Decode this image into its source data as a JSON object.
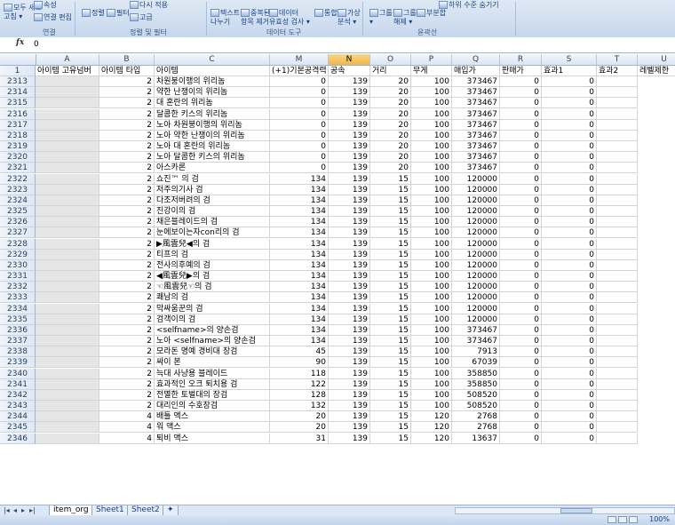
{
  "ribbon": {
    "buttons": [
      {
        "name": "refresh-all-button",
        "label": "모두 새로\n고침 ▾"
      },
      {
        "name": "properties-button",
        "label": "속성"
      },
      {
        "name": "edit-links-button",
        "label": "연결 편집"
      },
      {
        "name": "sort-button",
        "label": "정렬"
      },
      {
        "name": "filter-button",
        "label": "필터"
      },
      {
        "name": "reapply-button",
        "label": "다시 적용"
      },
      {
        "name": "advanced-button",
        "label": "고급"
      },
      {
        "name": "text-to-columns-button",
        "label": "텍스트\n나누기"
      },
      {
        "name": "remove-duplicates-button",
        "label": "중복된\n항목 제거"
      },
      {
        "name": "data-validation-button",
        "label": "데이터\n유효성 검사 ▾"
      },
      {
        "name": "consolidate-button",
        "label": "통합"
      },
      {
        "name": "what-if-button",
        "label": "가상\n분석 ▾"
      },
      {
        "name": "group-button",
        "label": "그룹\n▾"
      },
      {
        "name": "ungroup-button",
        "label": "그룹\n해제 ▾"
      },
      {
        "name": "subtotal-button",
        "label": "부분합"
      },
      {
        "name": "hide-detail-button",
        "label": "하위 수준 숨기기"
      }
    ],
    "groups": [
      "연결",
      "정렬 및 필터",
      "데이터 도구",
      "윤곽선"
    ]
  },
  "formula_bar": {
    "fx": "fx",
    "value": "0"
  },
  "columns": [
    {
      "letter": "A",
      "header": "아이템 고유넘버"
    },
    {
      "letter": "B",
      "header": "아이템 타입"
    },
    {
      "letter": "C",
      "header": "아이템"
    },
    {
      "letter": "M",
      "header": "(+1)기본공격력"
    },
    {
      "letter": "N",
      "header": "공속"
    },
    {
      "letter": "O",
      "header": "거리"
    },
    {
      "letter": "P",
      "header": "무게"
    },
    {
      "letter": "Q",
      "header": "매입가"
    },
    {
      "letter": "R",
      "header": "판매가"
    },
    {
      "letter": "S",
      "header": "효과1"
    },
    {
      "letter": "T",
      "header": "효과2"
    },
    {
      "letter": "U",
      "header": "레벨제한"
    }
  ],
  "header_row_number": "1",
  "rows": [
    [
      "2313",
      "",
      "2",
      "차원붕이행의 위리놈",
      "0",
      "139",
      "20",
      "100",
      "373467",
      "0",
      "0",
      ""
    ],
    [
      "2314",
      "",
      "2",
      "약한 난쟁이의 위리놈",
      "0",
      "139",
      "20",
      "100",
      "373467",
      "0",
      "0",
      ""
    ],
    [
      "2315",
      "",
      "2",
      "대 혼란의 위리놈",
      "0",
      "139",
      "20",
      "100",
      "373467",
      "0",
      "0",
      ""
    ],
    [
      "2316",
      "",
      "2",
      "달콤한 키스의 위리놈",
      "0",
      "139",
      "20",
      "100",
      "373467",
      "0",
      "0",
      ""
    ],
    [
      "2317",
      "",
      "2",
      "노아 차원붕이행의 위리놈",
      "0",
      "139",
      "20",
      "100",
      "373467",
      "0",
      "0",
      ""
    ],
    [
      "2318",
      "",
      "2",
      "노아 약한 난쟁이의 위리놈",
      "0",
      "139",
      "20",
      "100",
      "373467",
      "0",
      "0",
      ""
    ],
    [
      "2319",
      "",
      "2",
      "노아 대 혼란의 위리놈",
      "0",
      "139",
      "20",
      "100",
      "373467",
      "0",
      "0",
      ""
    ],
    [
      "2320",
      "",
      "2",
      "노아 달콤한 키스의 위리놈",
      "0",
      "139",
      "20",
      "100",
      "373467",
      "0",
      "0",
      ""
    ],
    [
      "2321",
      "",
      "2",
      "아스카론",
      "0",
      "139",
      "20",
      "100",
      "373467",
      "0",
      "0",
      ""
    ],
    [
      "2322",
      "",
      "2",
      "쇼진™ 의 검",
      "134",
      "139",
      "15",
      "100",
      "120000",
      "0",
      "0",
      ""
    ],
    [
      "2323",
      "",
      "2",
      "저주의기사 검",
      "134",
      "139",
      "15",
      "100",
      "120000",
      "0",
      "0",
      ""
    ],
    [
      "2324",
      "",
      "2",
      "다조저버려의 검",
      "134",
      "139",
      "15",
      "100",
      "120000",
      "0",
      "0",
      ""
    ],
    [
      "2325",
      "",
      "2",
      "진강이의 검",
      "134",
      "139",
      "15",
      "100",
      "120000",
      "0",
      "0",
      ""
    ],
    [
      "2326",
      "",
      "2",
      "채은블레이드의 검",
      "134",
      "139",
      "15",
      "100",
      "120000",
      "0",
      "0",
      ""
    ],
    [
      "2327",
      "",
      "2",
      "눈에보이는자con리의 검",
      "134",
      "139",
      "15",
      "100",
      "120000",
      "0",
      "0",
      ""
    ],
    [
      "2328",
      "",
      "2",
      "▶風雲兒◀의 검",
      "134",
      "139",
      "15",
      "100",
      "120000",
      "0",
      "0",
      ""
    ],
    [
      "2329",
      "",
      "2",
      "티프의 검",
      "134",
      "139",
      "15",
      "100",
      "120000",
      "0",
      "0",
      ""
    ],
    [
      "2330",
      "",
      "2",
      "전사의후예의 검",
      "134",
      "139",
      "15",
      "100",
      "120000",
      "0",
      "0",
      ""
    ],
    [
      "2331",
      "",
      "2",
      "◀風雲兒▶의 검",
      "134",
      "139",
      "15",
      "100",
      "120000",
      "0",
      "0",
      ""
    ],
    [
      "2332",
      "",
      "2",
      "☜風雲兒☜의 검",
      "134",
      "139",
      "15",
      "100",
      "120000",
      "0",
      "0",
      ""
    ],
    [
      "2333",
      "",
      "2",
      "쾌남의 검",
      "134",
      "139",
      "15",
      "100",
      "120000",
      "0",
      "0",
      ""
    ],
    [
      "2334",
      "",
      "2",
      "막싸움꾼의 검",
      "134",
      "139",
      "15",
      "100",
      "120000",
      "0",
      "0",
      ""
    ],
    [
      "2335",
      "",
      "2",
      "검객이의 검",
      "134",
      "139",
      "15",
      "100",
      "120000",
      "0",
      "0",
      ""
    ],
    [
      "2336",
      "",
      "2",
      "<selfname>의 양손검",
      "134",
      "139",
      "15",
      "100",
      "373467",
      "0",
      "0",
      ""
    ],
    [
      "2337",
      "",
      "2",
      "노아 <selfname>의 양손검",
      "134",
      "139",
      "15",
      "100",
      "373467",
      "0",
      "0",
      ""
    ],
    [
      "2338",
      "",
      "2",
      "모라돈 명예 경비대 장검",
      "45",
      "139",
      "15",
      "100",
      "7913",
      "0",
      "0",
      ""
    ],
    [
      "2339",
      "",
      "2",
      "싸이 본",
      "90",
      "139",
      "15",
      "100",
      "67039",
      "0",
      "0",
      ""
    ],
    [
      "2340",
      "",
      "2",
      "늑대 사냥용 블레이드",
      "118",
      "139",
      "15",
      "100",
      "358850",
      "0",
      "0",
      ""
    ],
    [
      "2341",
      "",
      "2",
      "효과적인 오크 퇴치용 검",
      "122",
      "139",
      "15",
      "100",
      "358850",
      "0",
      "0",
      ""
    ],
    [
      "2342",
      "",
      "2",
      "전멸한 토벌대의 장검",
      "128",
      "139",
      "15",
      "100",
      "508520",
      "0",
      "0",
      ""
    ],
    [
      "2343",
      "",
      "2",
      "대리인의 수호장검",
      "132",
      "139",
      "15",
      "100",
      "508520",
      "0",
      "0",
      ""
    ],
    [
      "2344",
      "",
      "4",
      "배틀 액스",
      "20",
      "139",
      "15",
      "120",
      "2768",
      "0",
      "0",
      ""
    ],
    [
      "2345",
      "",
      "4",
      "워 액스",
      "20",
      "139",
      "15",
      "120",
      "2768",
      "0",
      "0",
      ""
    ],
    [
      "2346",
      "",
      "4",
      "퇴비 액스",
      "31",
      "139",
      "15",
      "120",
      "13637",
      "0",
      "0",
      ""
    ]
  ],
  "tabs": [
    "item_org",
    "Sheet1",
    "Sheet2"
  ],
  "active_tab": "item_org",
  "zoom": "100%",
  "colors": {
    "selected_column": "#f2b54a",
    "ribbon": "#c6d7ec"
  }
}
